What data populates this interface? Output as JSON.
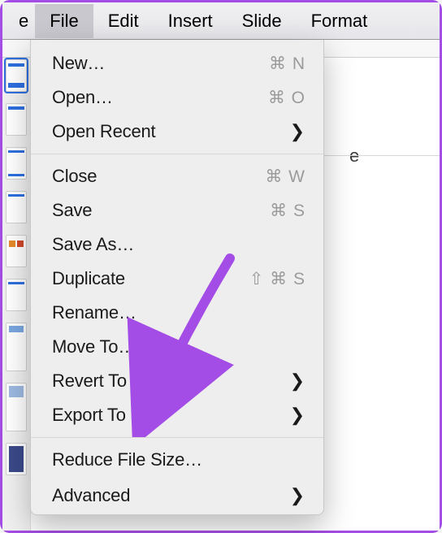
{
  "menubar": {
    "fragment": "e",
    "items": [
      "File",
      "Edit",
      "Insert",
      "Slide",
      "Format"
    ],
    "active_index": 0
  },
  "background": {
    "text_fragment": "e"
  },
  "file_menu": {
    "groups": [
      [
        {
          "label": "New…",
          "shortcut": "⌘ N"
        },
        {
          "label": "Open…",
          "shortcut": "⌘ O"
        },
        {
          "label": "Open Recent",
          "submenu": true
        }
      ],
      [
        {
          "label": "Close",
          "shortcut": "⌘ W"
        },
        {
          "label": "Save",
          "shortcut": "⌘ S"
        },
        {
          "label": "Save As…"
        },
        {
          "label": "Duplicate",
          "shortcut": "⇧ ⌘ S"
        },
        {
          "label": "Rename…"
        },
        {
          "label": "Move To…"
        },
        {
          "label": "Revert To",
          "submenu": true
        },
        {
          "label": "Export To",
          "submenu": true
        }
      ],
      [
        {
          "label": "Reduce File Size…"
        },
        {
          "label": "Advanced",
          "submenu": true
        }
      ]
    ]
  },
  "annotation": {
    "color": "#a44de6"
  }
}
